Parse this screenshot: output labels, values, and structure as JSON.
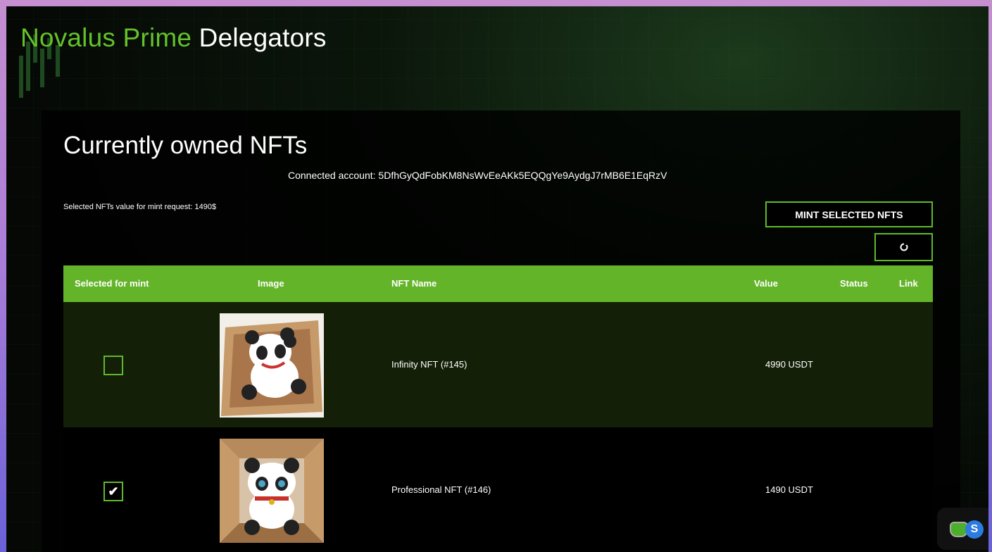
{
  "site": {
    "title_green": "Novalus Prime",
    "title_white": "Delegators"
  },
  "panel": {
    "title": "Currently owned NFTs",
    "account_text": "Connected account: 5DfhGyQdFobKM8NsWvEeAKk5EQQgYe9AydgJ7rMB6E1EqRzV",
    "selected_value_text": "Selected NFTs value for mint request: 1490$",
    "mint_button_label": "MINT SELECTED NFTS",
    "refresh_icon": "refresh-icon"
  },
  "table": {
    "headers": {
      "selected": "Selected for mint",
      "image": "Image",
      "name": "NFT Name",
      "value": "Value",
      "status": "Status",
      "link": "Link"
    },
    "rows": [
      {
        "checked": false,
        "image_icon": "panda-nft-image",
        "name": "Infinity NFT (#145)",
        "value": "4990 USDT",
        "status": "",
        "link": ""
      },
      {
        "checked": true,
        "image_icon": "panda-nft-image",
        "name": "Professional NFT (#146)",
        "value": "1490 USDT",
        "status": "",
        "link": ""
      }
    ]
  },
  "colors": {
    "accent_green": "#64b42a",
    "border_green": "#5fb92e",
    "title_green": "#63c22a"
  }
}
